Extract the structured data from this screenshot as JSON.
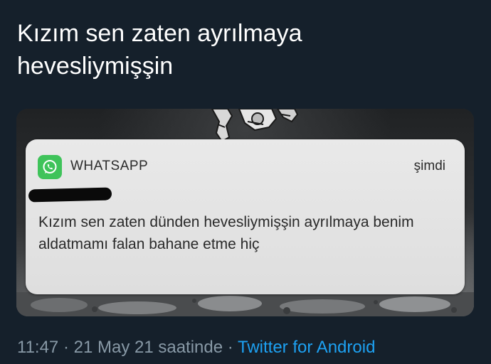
{
  "tweet": {
    "text": "Kızım sen zaten ayrılmaya\nhevesliymişşin"
  },
  "notification": {
    "app_icon": "whatsapp-icon",
    "app_name": "WHATSAPP",
    "time": "şimdi",
    "message": "Kızım sen zaten dünden hevesliymişşin ayrılmaya benim aldatmamı falan bahane etme hiç"
  },
  "meta": {
    "time": "11:47",
    "separator1": " · ",
    "date": "21 May 21 saatinde",
    "separator2": " · ",
    "source": "Twitter for Android"
  },
  "colors": {
    "background": "#15202b",
    "meta_text": "#8899a6",
    "link": "#1da1f2",
    "whatsapp_green": "#3fc35a"
  }
}
